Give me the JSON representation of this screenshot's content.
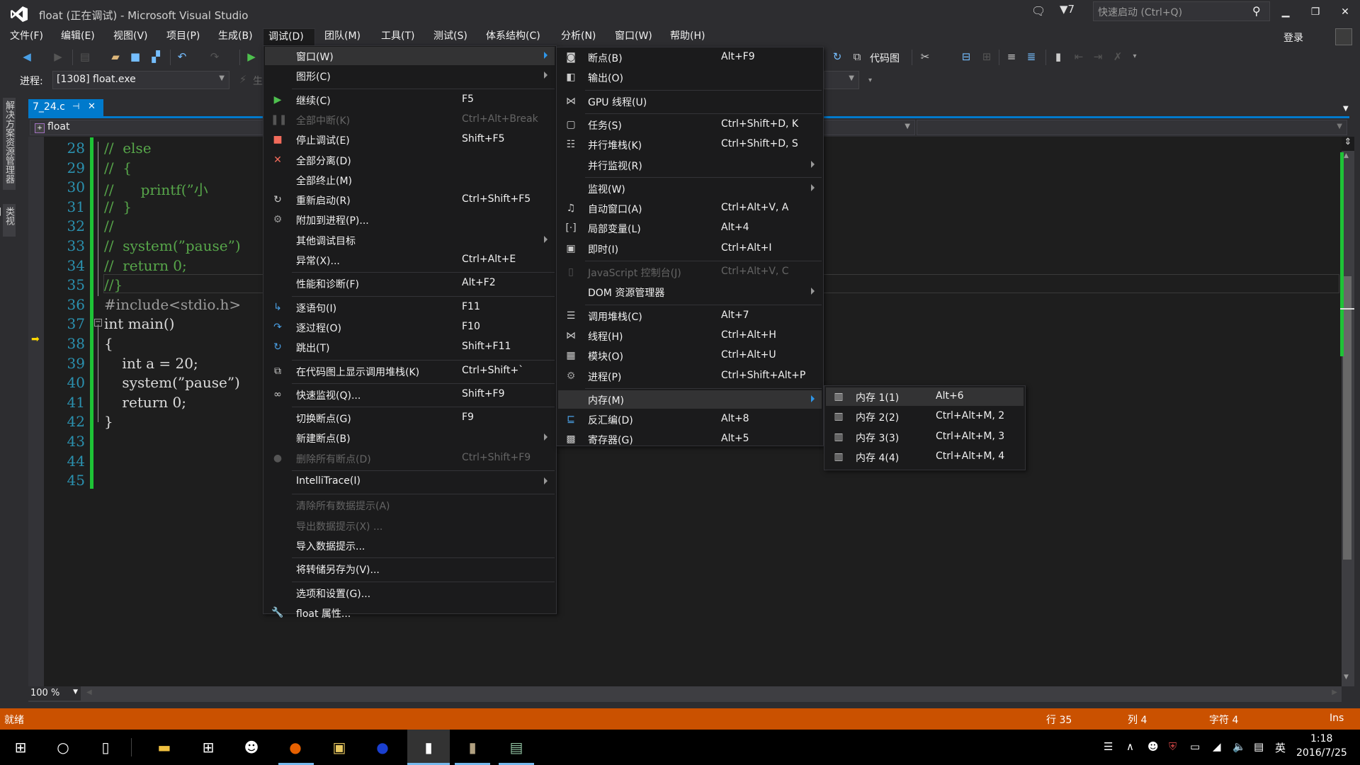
{
  "window": {
    "title": "float (正在调试) - Microsoft Visual Studio",
    "notifications_count": "7",
    "quick_launch_placeholder": "快速启动 (Ctrl+Q)",
    "login_label": "登录"
  },
  "menubar": {
    "items": [
      "文件(F)",
      "编辑(E)",
      "视图(V)",
      "项目(P)",
      "生成(B)",
      "调试(D)",
      "团队(M)",
      "工具(T)",
      "测试(S)",
      "体系结构(C)",
      "分析(N)",
      "窗口(W)",
      "帮助(H)"
    ],
    "active": "调试(D)"
  },
  "toolbar": {
    "code_map_label": "代码图",
    "process_label": "进程:",
    "process_value": "[1308] float.exe",
    "lifecycle_partial": "生"
  },
  "side_tabs": [
    "解决方案资源管理器",
    "类视图"
  ],
  "document": {
    "tab_label": "7_24.c",
    "pin_glyph": "⊸",
    "close_glyph": "✕",
    "scope": "float",
    "zoom": "100 %"
  },
  "code": {
    "lines": [
      {
        "n": "28",
        "text": "//  else"
      },
      {
        "n": "29",
        "text": "//  {"
      },
      {
        "n": "30",
        "text": "//      printf(”小"
      },
      {
        "n": "31",
        "text": "//  }"
      },
      {
        "n": "32",
        "text": "//"
      },
      {
        "n": "33",
        "text": "//  system(”pause”)"
      },
      {
        "n": "34",
        "text": "//  return 0;"
      },
      {
        "n": "35",
        "text": "//}"
      },
      {
        "n": "36",
        "text": "#include<stdio.h>"
      },
      {
        "n": "37",
        "text": "int main()"
      },
      {
        "n": "38",
        "text": "{"
      },
      {
        "n": "39",
        "text": "    int a = 20;"
      },
      {
        "n": "40",
        "text": "    system(”pause”)"
      },
      {
        "n": "41",
        "text": "    return 0;"
      },
      {
        "n": "42",
        "text": "}"
      },
      {
        "n": "43",
        "text": ""
      },
      {
        "n": "44",
        "text": ""
      },
      {
        "n": "45",
        "text": ""
      }
    ],
    "current_exec_line": "38"
  },
  "debug_menu": {
    "items": [
      {
        "label": "窗口(W)",
        "shortcut": "",
        "submenu": true,
        "icon": "",
        "highlighted": true
      },
      {
        "label": "图形(C)",
        "shortcut": "",
        "submenu": true,
        "icon": ""
      },
      {
        "label": "继续(C)",
        "shortcut": "F5",
        "icon": "play-icon"
      },
      {
        "label": "全部中断(K)",
        "shortcut": "Ctrl+Alt+Break",
        "icon": "pause-icon",
        "disabled": true
      },
      {
        "label": "停止调试(E)",
        "shortcut": "Shift+F5",
        "icon": "stop-icon"
      },
      {
        "label": "全部分离(D)",
        "shortcut": "",
        "icon": "detach-x-icon"
      },
      {
        "label": "全部终止(M)",
        "shortcut": "",
        "icon": ""
      },
      {
        "label": "重新启动(R)",
        "shortcut": "Ctrl+Shift+F5",
        "icon": "restart-icon"
      },
      {
        "label": "附加到进程(P)...",
        "shortcut": "",
        "icon": "gears-icon"
      },
      {
        "label": "其他调试目标",
        "shortcut": "",
        "submenu": true,
        "icon": ""
      },
      {
        "label": "异常(X)...",
        "shortcut": "Ctrl+Alt+E",
        "icon": ""
      },
      {
        "label": "性能和诊断(F)",
        "shortcut": "Alt+F2",
        "icon": ""
      },
      {
        "label": "逐语句(I)",
        "shortcut": "F11",
        "icon": "step-into-icon"
      },
      {
        "label": "逐过程(O)",
        "shortcut": "F10",
        "icon": "step-over-icon"
      },
      {
        "label": "跳出(T)",
        "shortcut": "Shift+F11",
        "icon": "step-out-icon"
      },
      {
        "label": "在代码图上显示调用堆栈(K)",
        "shortcut": "Ctrl+Shift+`",
        "icon": "code-map-icon"
      },
      {
        "label": "快速监视(Q)...",
        "shortcut": "Shift+F9",
        "icon": "glasses-icon"
      },
      {
        "label": "切换断点(G)",
        "shortcut": "F9",
        "icon": ""
      },
      {
        "label": "新建断点(B)",
        "shortcut": "",
        "submenu": true,
        "icon": ""
      },
      {
        "label": "删除所有断点(D)",
        "shortcut": "Ctrl+Shift+F9",
        "icon": "delete-breakpoints-icon",
        "disabled": true
      },
      {
        "label": "IntelliTrace(I)",
        "shortcut": "",
        "submenu": true,
        "icon": ""
      },
      {
        "label": "清除所有数据提示(A)",
        "shortcut": "",
        "icon": "",
        "disabled": true
      },
      {
        "label": "导出数据提示(X) ...",
        "shortcut": "",
        "icon": "",
        "disabled": true
      },
      {
        "label": "导入数据提示...",
        "shortcut": "",
        "icon": ""
      },
      {
        "label": "将转储另存为(V)...",
        "shortcut": "",
        "icon": ""
      },
      {
        "label": "选项和设置(G)...",
        "shortcut": "",
        "icon": ""
      },
      {
        "label": "float 属性...",
        "shortcut": "",
        "icon": "wrench-icon"
      }
    ]
  },
  "window_submenu": {
    "items": [
      {
        "label": "断点(B)",
        "shortcut": "Alt+F9",
        "icon": "breakpoints-icon"
      },
      {
        "label": "输出(O)",
        "shortcut": "",
        "icon": "output-icon"
      },
      {
        "label": "GPU 线程(U)",
        "shortcut": "",
        "icon": "threads-icon"
      },
      {
        "label": "任务(S)",
        "shortcut": "Ctrl+Shift+D, K",
        "icon": "tasks-icon"
      },
      {
        "label": "并行堆栈(K)",
        "shortcut": "Ctrl+Shift+D, S",
        "icon": "parallel-stacks-icon"
      },
      {
        "label": "并行监视(R)",
        "shortcut": "",
        "submenu": true,
        "icon": ""
      },
      {
        "label": "监视(W)",
        "shortcut": "",
        "submenu": true,
        "icon": ""
      },
      {
        "label": "自动窗口(A)",
        "shortcut": "Ctrl+Alt+V, A",
        "icon": "autos-icon"
      },
      {
        "label": "局部变量(L)",
        "shortcut": "Alt+4",
        "icon": "locals-icon"
      },
      {
        "label": "即时(I)",
        "shortcut": "Ctrl+Alt+I",
        "icon": "immediate-icon"
      },
      {
        "label": "JavaScript 控制台(J)",
        "shortcut": "Ctrl+Alt+V, C",
        "icon": "js-console-icon",
        "disabled": true
      },
      {
        "label": "DOM 资源管理器",
        "shortcut": "",
        "submenu": true,
        "icon": ""
      },
      {
        "label": "调用堆栈(C)",
        "shortcut": "Alt+7",
        "icon": "call-stack-icon"
      },
      {
        "label": "线程(H)",
        "shortcut": "Ctrl+Alt+H",
        "icon": "threads-icon"
      },
      {
        "label": "模块(O)",
        "shortcut": "Ctrl+Alt+U",
        "icon": "modules-icon"
      },
      {
        "label": "进程(P)",
        "shortcut": "Ctrl+Shift+Alt+P",
        "icon": "processes-icon"
      },
      {
        "label": "内存(M)",
        "shortcut": "",
        "submenu": true,
        "icon": "",
        "highlighted": true
      },
      {
        "label": "反汇编(D)",
        "shortcut": "Alt+8",
        "icon": "disassembly-icon"
      },
      {
        "label": "寄存器(G)",
        "shortcut": "Alt+5",
        "icon": "registers-icon"
      }
    ]
  },
  "memory_submenu": {
    "items": [
      {
        "label": "内存 1(1)",
        "shortcut": "Alt+6",
        "icon": "memory-chip-icon",
        "highlighted": true
      },
      {
        "label": "内存 2(2)",
        "shortcut": "Ctrl+Alt+M, 2",
        "icon": "memory-chip-icon"
      },
      {
        "label": "内存 3(3)",
        "shortcut": "Ctrl+Alt+M, 3",
        "icon": "memory-chip-icon"
      },
      {
        "label": "内存 4(4)",
        "shortcut": "Ctrl+Alt+M, 4",
        "icon": "memory-chip-icon"
      }
    ]
  },
  "statusbar": {
    "status": "就绪",
    "line": "行 35",
    "col": "列 4",
    "char": "字符 4",
    "mode": "Ins",
    "color": "#CA5100"
  },
  "taskbar": {
    "apps": [
      "start",
      "cortana",
      "task-view",
      "file-explorer",
      "store",
      "qq",
      "firefox",
      "cpp-tool",
      "msdn",
      "document",
      "photo",
      "app-window"
    ],
    "ime": "英",
    "time": "1:18",
    "date": "2016/7/25"
  },
  "colors": {
    "accent": "#007ACC",
    "change_margin": "#1EC336",
    "comment": "#57A64A",
    "keyword": "#569CD6"
  }
}
